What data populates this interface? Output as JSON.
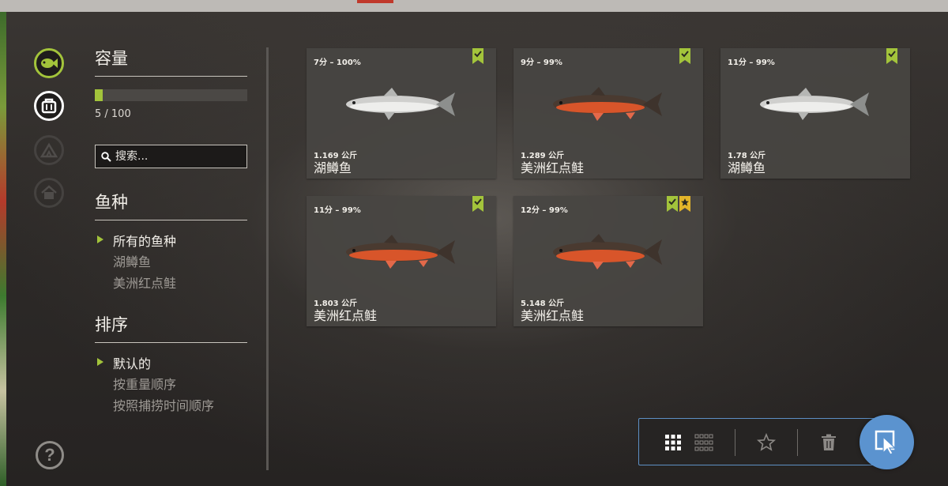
{
  "sidebar": {
    "capacity": {
      "title": "容量",
      "value": 5,
      "max": 100,
      "text": "5 / 100"
    },
    "search": {
      "placeholder": "搜索..."
    },
    "species": {
      "title": "鱼种",
      "items": [
        {
          "label": "所有的鱼种",
          "selected": true
        },
        {
          "label": "湖鳟鱼",
          "selected": false
        },
        {
          "label": "美洲红点鲑",
          "selected": false
        }
      ]
    },
    "sort": {
      "title": "排序",
      "items": [
        {
          "label": "默认的",
          "selected": true
        },
        {
          "label": "按重量顺序",
          "selected": false
        },
        {
          "label": "按照捕捞时间顺序",
          "selected": false
        }
      ]
    }
  },
  "nav_icons": [
    "fish-icon",
    "keepnet-icon",
    "tent-icon",
    "home-icon",
    "help-icon"
  ],
  "fish_cards": [
    {
      "score": "7分 – 100%",
      "weight": "1.169 公斤",
      "name": "湖鳟鱼",
      "species": "lake-trout",
      "badges": [
        "check"
      ]
    },
    {
      "score": "9分 – 99%",
      "weight": "1.289 公斤",
      "name": "美洲红点鲑",
      "species": "brook-trout",
      "badges": [
        "check"
      ]
    },
    {
      "score": "11分 – 99%",
      "weight": "1.78 公斤",
      "name": "湖鳟鱼",
      "species": "lake-trout",
      "badges": [
        "check"
      ]
    },
    {
      "score": "11分 – 99%",
      "weight": "1.803 公斤",
      "name": "美洲红点鲑",
      "species": "brook-trout",
      "badges": [
        "check"
      ]
    },
    {
      "score": "12分 – 99%",
      "weight": "5.148 公斤",
      "name": "美洲红点鲑",
      "species": "brook-trout",
      "badges": [
        "check",
        "star"
      ]
    }
  ],
  "toolbar": {
    "buttons": [
      "large-grid-icon",
      "small-grid-icon",
      "star-icon",
      "trash-icon",
      "cursor-icon"
    ]
  },
  "colors": {
    "accent": "#a3c43b",
    "toolbar_border": "#5d8fc4",
    "fab": "#5b93cf",
    "star_badge": "#e3b52a"
  }
}
